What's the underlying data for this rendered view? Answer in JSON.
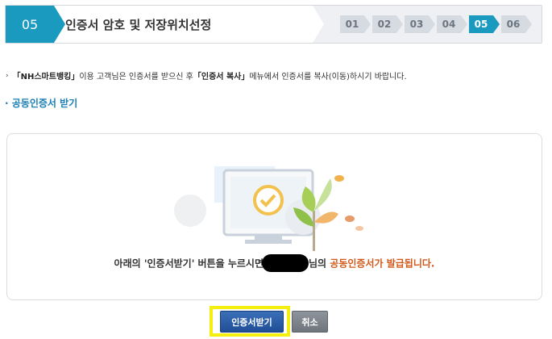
{
  "header": {
    "current_step_number": "05",
    "title": "인증서 암호 및 저장위치선정",
    "steps": [
      "01",
      "02",
      "03",
      "04",
      "05",
      "06"
    ],
    "active_step_index": 4
  },
  "notice": {
    "part1": "「NH스마트뱅킹」",
    "part2": " 이용 고객님은 인증서를 받으신 후 ",
    "part3": "「인증서 복사」",
    "part4": " 메뉴에서 인증서를 복사(이동)하시기 바랍니다."
  },
  "section": {
    "title": "· 공동인증서 받기"
  },
  "message": {
    "prefix": "아래의 '인증서받기' 버튼을 누르시면",
    "middle": "님의 ",
    "highlight": "공동인증서가 발급됩니다."
  },
  "buttons": {
    "receive": "인증서받기",
    "cancel": "취소"
  },
  "colors": {
    "accent": "#1b9ac0",
    "highlight_text": "#d25a1c",
    "focus_box": "#f5ef10"
  }
}
